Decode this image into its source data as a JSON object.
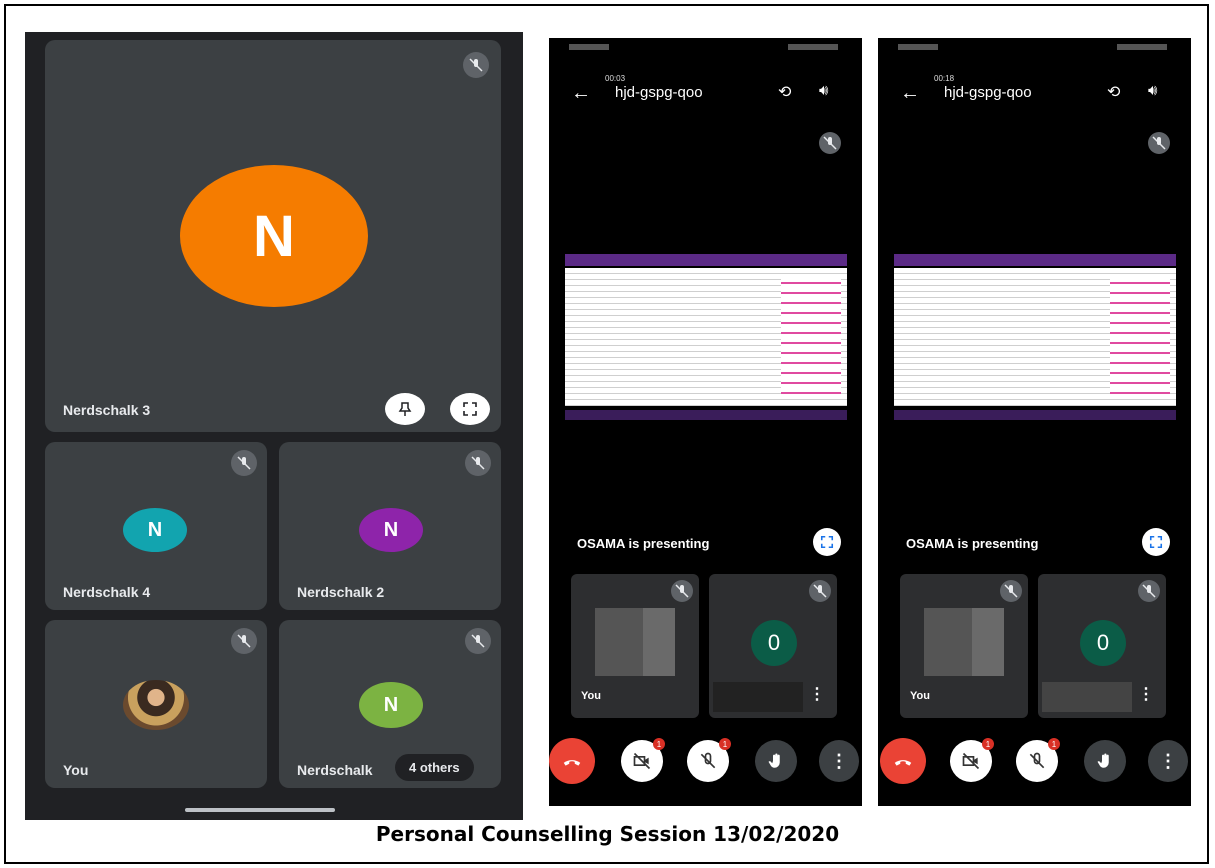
{
  "caption": "Personal Counselling Session 13/02/2020",
  "left_panel": {
    "main_tile": {
      "name": "Nerdschalk 3",
      "initial": "N",
      "avatar_color": "#f57c00"
    },
    "tiles": [
      {
        "name": "Nerdschalk 4",
        "initial": "N",
        "avatar_color": "#12a4af"
      },
      {
        "name": "Nerdschalk 2",
        "initial": "N",
        "avatar_color": "#8e24aa"
      },
      {
        "name": "You"
      },
      {
        "name": "Nerdschalk",
        "initial": "N",
        "avatar_color": "#7cb342"
      }
    ],
    "others_label": "4 others"
  },
  "phones": [
    {
      "timer": "00:03",
      "meeting_code": "hjd-gspg-qoo",
      "presenting_text": "OSAMA is presenting",
      "you_label": "You",
      "participant_initial": "0",
      "badge_video": "1",
      "badge_mic": "1"
    },
    {
      "timer": "00:18",
      "meeting_code": "hjd-gspg-qoo",
      "presenting_text": "OSAMA is presenting",
      "you_label": "You",
      "participant_initial": "0",
      "badge_video": "1",
      "badge_mic": "1"
    }
  ],
  "colors": {
    "end_call": "#ea4335",
    "tile_bg": "#3c4043",
    "panel_bg": "#202124"
  },
  "icons": [
    "mic-off-icon",
    "pin-icon",
    "fullscreen-icon",
    "back-arrow-icon",
    "switch-camera-icon",
    "speaker-icon",
    "end-call-icon",
    "video-off-icon",
    "raise-hand-icon",
    "more-vert-icon"
  ]
}
